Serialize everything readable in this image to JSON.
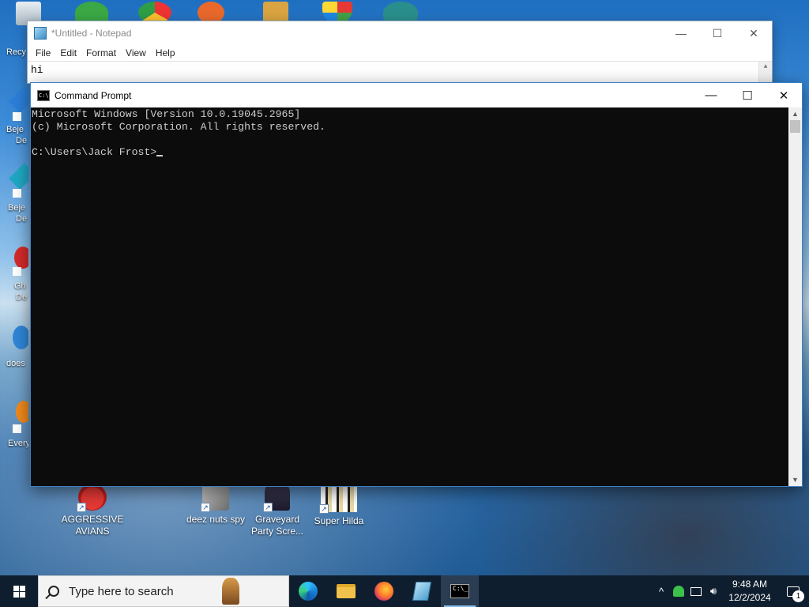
{
  "desktop": {
    "left_labels": [
      "Recy",
      "Beje",
      "De",
      "Beje",
      "De",
      "Gh",
      "De",
      "does",
      "Every"
    ],
    "icons": [
      {
        "label": "AGGRESSIVE AVIANS",
        "icon": "angry-bird-icon"
      },
      {
        "label": "deez nuts spy",
        "icon": "app-icon"
      },
      {
        "label": "Graveyard Party Scre...",
        "icon": "graveyard-icon"
      },
      {
        "label": "Super Hilda",
        "icon": "pixel-game-icon"
      }
    ]
  },
  "notepad": {
    "title": "*Untitled - Notepad",
    "menu": [
      "File",
      "Edit",
      "Format",
      "View",
      "Help"
    ],
    "content": "hi",
    "buttons": {
      "minimize": "—",
      "maximize": "☐",
      "close": "✕"
    }
  },
  "cmd": {
    "title": "Command Prompt",
    "lines": [
      "Microsoft Windows [Version 10.0.19045.2965]",
      "(c) Microsoft Corporation. All rights reserved.",
      "",
      "C:\\Users\\Jack Frost>"
    ],
    "buttons": {
      "minimize": "—",
      "maximize": "☐",
      "close": "✕"
    }
  },
  "taskbar": {
    "search_placeholder": "Type here to search",
    "apps": [
      "edge-icon",
      "file-explorer-icon",
      "firefox-icon",
      "notepad-icon",
      "command-prompt-icon"
    ],
    "tray": {
      "chevron": "^",
      "time": "9:48 AM",
      "date": "12/2/2024",
      "notification_count": "1"
    }
  }
}
